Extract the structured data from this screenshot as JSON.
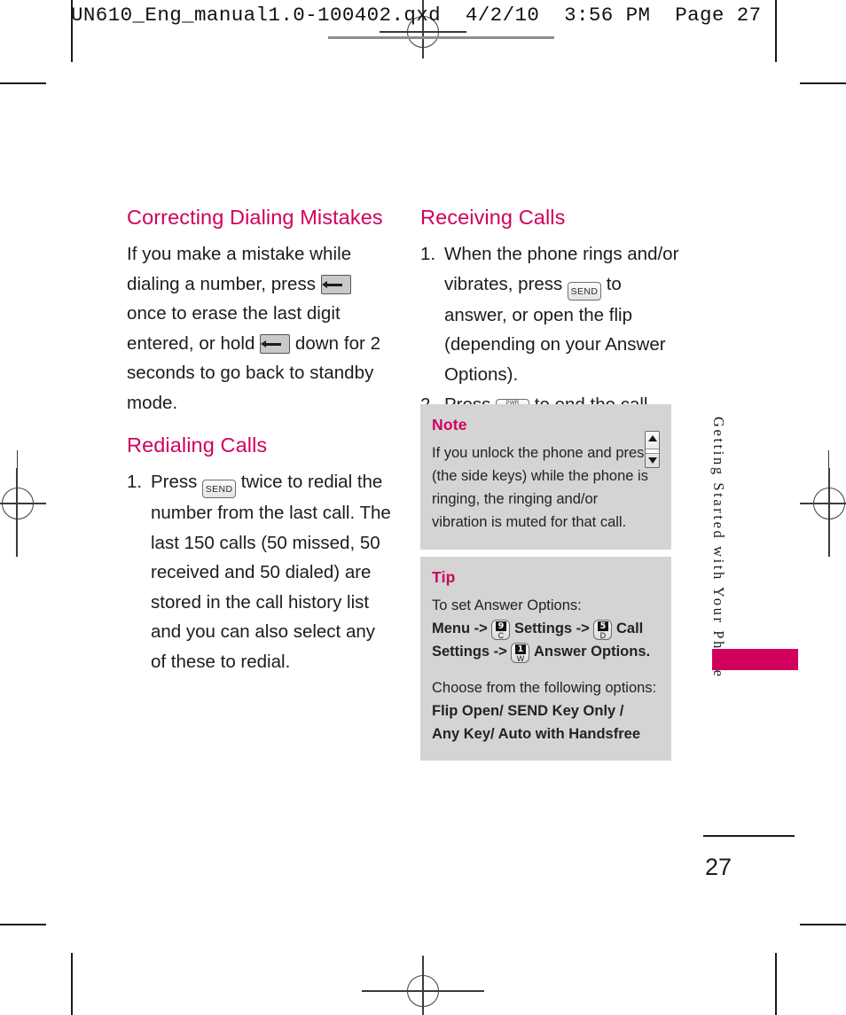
{
  "header": {
    "filename_line": "UN610_Eng_manual1.0-100402.qxd  4/2/10  3:56 PM  Page 27"
  },
  "left_column": {
    "section1": {
      "heading": "Correcting Dialing Mistakes",
      "text_part1": "If you make a mistake while dialing a number, press ",
      "text_part2": " once to erase the last digit entered, or hold ",
      "text_part3": " down for 2 seconds to go back to standby mode.",
      "key1_label": "clear-key",
      "key2_label": "clear-key"
    },
    "section2": {
      "heading": "Redialing Calls",
      "step1_number": "1.",
      "step1_part1": "Press ",
      "step1_key": "SEND",
      "step1_part2": " twice to redial the number from the last call. The last 150 calls (50 missed, 50 received and 50 dialed) are stored in the call history list and you can also select any of these to redial."
    }
  },
  "right_column": {
    "heading": "Receiving Calls",
    "step1_number": "1.",
    "step1_part1": "When the phone rings and/or vibrates, press ",
    "step1_key": "SEND",
    "step1_part2": " to answer, or open the flip (depending on your Answer Options).",
    "step2_number": "2.",
    "step2_part1": "Press ",
    "step2_key_top": "PWR",
    "step2_key_main": "END",
    "step2_part2": " to end the call."
  },
  "note_box": {
    "title": "Note",
    "text": "If you unlock the phone and press (the side keys) while the phone is ringing, the ringing and/or vibration is muted for that call.",
    "sidekey_icon": "side-key-up-down"
  },
  "tip_box": {
    "title": "Tip",
    "line1": "To set Answer Options:",
    "path_menu": "Menu ->",
    "key_9c_digit": "9",
    "key_9c_letter": "C",
    "path_settings": "Settings ->",
    "key_5d_digit": "5",
    "key_5d_letter": "D",
    "path_call": "Call",
    "path_settings2": "Settings ->",
    "key_1w_digit": "1",
    "key_1w_letter": "W",
    "path_answer": "Answer Options.",
    "line_choose": "Choose from the following options:",
    "options_line1": "Flip Open/ SEND Key Only /",
    "options_line2": "Any Key/ Auto with Handsfree"
  },
  "running_head": {
    "text": "Getting Started with Your Phone"
  },
  "folio": {
    "page_number": "27"
  },
  "colors": {
    "accent": "#D1005D",
    "callout_bg": "#d4d4d4",
    "body_text": "#1c1c1c"
  }
}
